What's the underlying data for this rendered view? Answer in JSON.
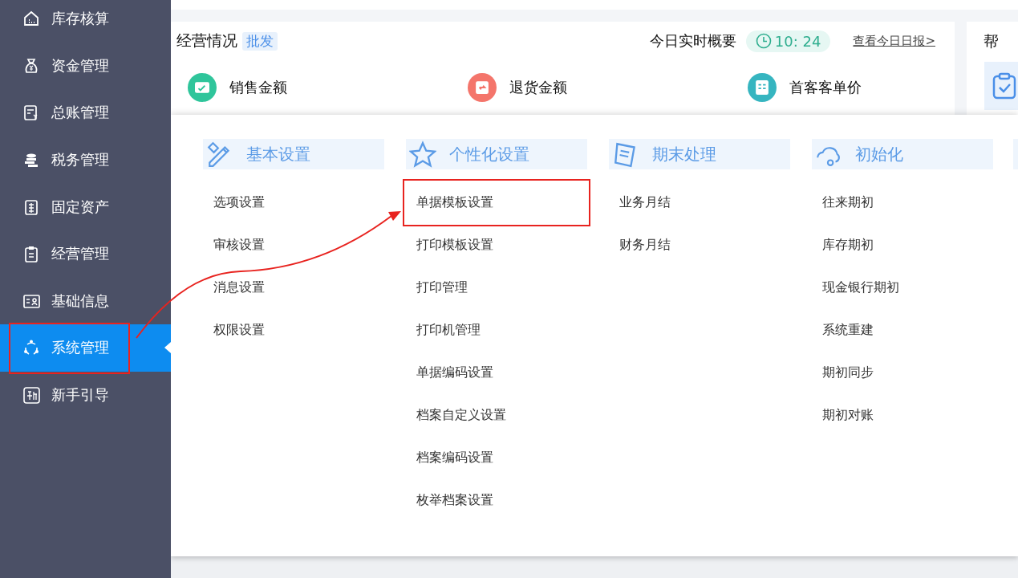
{
  "sidebar": {
    "items": [
      {
        "label": "库存核算",
        "selected": false,
        "annotated": false
      },
      {
        "label": "资金管理",
        "selected": false,
        "annotated": false
      },
      {
        "label": "总账管理",
        "selected": false,
        "annotated": false
      },
      {
        "label": "税务管理",
        "selected": false,
        "annotated": false
      },
      {
        "label": "固定资产",
        "selected": false,
        "annotated": false
      },
      {
        "label": "经营管理",
        "selected": false,
        "annotated": false
      },
      {
        "label": "基础信息",
        "selected": false,
        "annotated": false
      },
      {
        "label": "系统管理",
        "selected": true,
        "annotated": true
      },
      {
        "label": "新手引导",
        "selected": false,
        "annotated": false
      }
    ]
  },
  "dashboard": {
    "title": "经营情况",
    "tag": "批发",
    "summary_label": "今日实时概要",
    "time": "10: 24",
    "report_link": "查看今日日报>",
    "help": "帮",
    "metrics": [
      {
        "label": "销售金额",
        "color": "#2fc59b"
      },
      {
        "label": "退货金额",
        "color": "#f4756b"
      },
      {
        "label": "首客客单价",
        "color": "#36b5c0"
      }
    ]
  },
  "flyout": {
    "columns": [
      {
        "title": "基本设置",
        "items": [
          {
            "label": "选项设置",
            "annotated": false
          },
          {
            "label": "审核设置",
            "annotated": false
          },
          {
            "label": "消息设置",
            "annotated": false
          },
          {
            "label": "权限设置",
            "annotated": false
          }
        ]
      },
      {
        "title": "个性化设置",
        "items": [
          {
            "label": "单据模板设置",
            "annotated": true
          },
          {
            "label": "打印模板设置",
            "annotated": false
          },
          {
            "label": "打印管理",
            "annotated": false
          },
          {
            "label": "打印机管理",
            "annotated": false
          },
          {
            "label": "单据编码设置",
            "annotated": false
          },
          {
            "label": "档案自定义设置",
            "annotated": false
          },
          {
            "label": "档案编码设置",
            "annotated": false
          },
          {
            "label": "枚举档案设置",
            "annotated": false
          }
        ]
      },
      {
        "title": "期末处理",
        "items": [
          {
            "label": "业务月结",
            "annotated": false
          },
          {
            "label": "财务月结",
            "annotated": false
          }
        ]
      },
      {
        "title": "初始化",
        "items": [
          {
            "label": "往来期初",
            "annotated": false
          },
          {
            "label": "库存期初",
            "annotated": false
          },
          {
            "label": "现金银行期初",
            "annotated": false
          },
          {
            "label": "系统重建",
            "annotated": false
          },
          {
            "label": "期初同步",
            "annotated": false
          },
          {
            "label": "期初对账",
            "annotated": false
          }
        ]
      }
    ]
  }
}
